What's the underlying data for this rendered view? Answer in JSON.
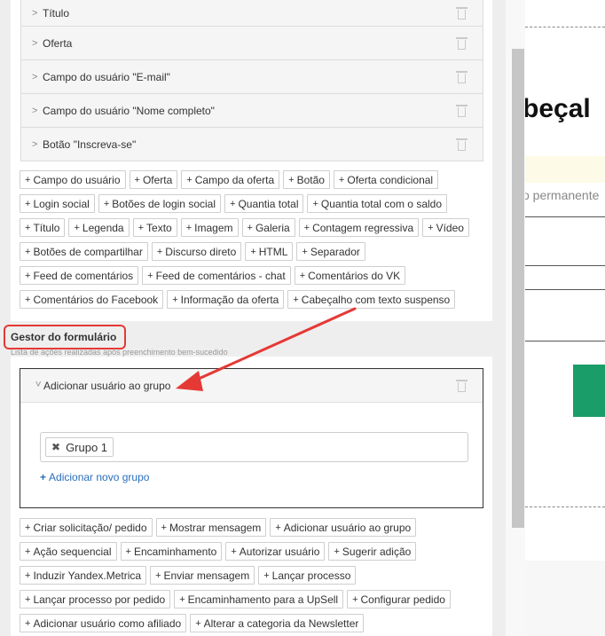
{
  "elements_list": [
    {
      "label": "Título"
    },
    {
      "label": "Oferta"
    },
    {
      "label": "Campo do usuário \"E-mail\""
    },
    {
      "label": "Campo do usuário \"Nome completo\""
    },
    {
      "label": "Botão \"Inscreva-se\""
    }
  ],
  "element_buttons": [
    "Campo do usuário",
    "Oferta",
    "Campo da oferta",
    "Botão",
    "Oferta condicional",
    "Login social",
    "Botões de login social",
    "Quantia total",
    "Quantia total com o saldo",
    "Título",
    "Legenda",
    "Texto",
    "Imagem",
    "Galeria",
    "Contagem regressiva",
    "Vídeo",
    "Botões de compartilhar",
    "Discurso direto",
    "HTML",
    "Separador",
    "Feed de comentários",
    "Feed de comentários - chat",
    "Comentários do VK",
    "Comentários do Facebook",
    "Informação da oferta",
    "Cabeçalho com texto suspenso"
  ],
  "form_manager": {
    "title": "Gestor do formulário",
    "subtitle": "Lista de ações realizadas após preenchimento bem-sucedido",
    "action": {
      "title": "Adicionar usuário ao grupo",
      "selected_group": "Grupo 1",
      "add_group_link": "Adicionar novo grupo"
    }
  },
  "action_buttons": [
    "Criar solicitação/ pedido",
    "Mostrar mensagem",
    "Adicionar usuário ao grupo",
    "Ação sequencial",
    "Encaminhamento",
    "Autorizar usuário",
    "Sugerir adição",
    "Induzir Yandex.Metrica",
    "Enviar mensagem",
    "Lançar processo",
    "Lançar processo por pedido",
    "Encaminhamento para a UpSell",
    "Configurar pedido",
    "Adicionar usuário como afiliado",
    "Alterar a categoria da Newsletter"
  ],
  "preview": {
    "heading_fragment": "beçal",
    "text_fragment": "o permanente"
  },
  "colors": {
    "highlight": "#e53935",
    "link": "#2a6ebb",
    "green": "#1a9d68"
  }
}
